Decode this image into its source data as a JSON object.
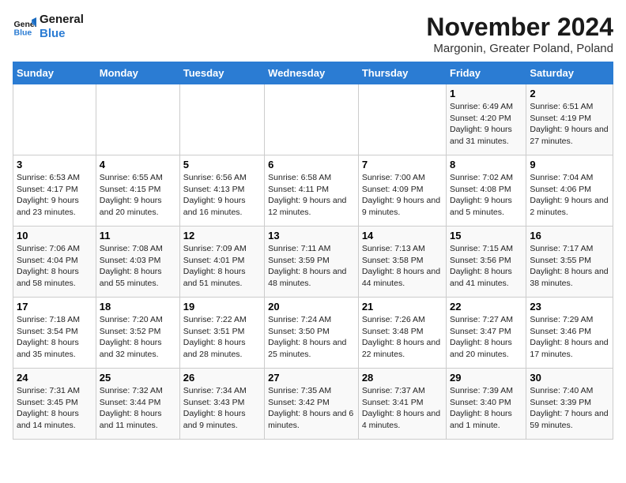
{
  "logo": {
    "line1": "General",
    "line2": "Blue"
  },
  "title": "November 2024",
  "subtitle": "Margonin, Greater Poland, Poland",
  "days_of_week": [
    "Sunday",
    "Monday",
    "Tuesday",
    "Wednesday",
    "Thursday",
    "Friday",
    "Saturday"
  ],
  "weeks": [
    [
      {
        "day": "",
        "info": ""
      },
      {
        "day": "",
        "info": ""
      },
      {
        "day": "",
        "info": ""
      },
      {
        "day": "",
        "info": ""
      },
      {
        "day": "",
        "info": ""
      },
      {
        "day": "1",
        "info": "Sunrise: 6:49 AM\nSunset: 4:20 PM\nDaylight: 9 hours and 31 minutes."
      },
      {
        "day": "2",
        "info": "Sunrise: 6:51 AM\nSunset: 4:19 PM\nDaylight: 9 hours and 27 minutes."
      }
    ],
    [
      {
        "day": "3",
        "info": "Sunrise: 6:53 AM\nSunset: 4:17 PM\nDaylight: 9 hours and 23 minutes."
      },
      {
        "day": "4",
        "info": "Sunrise: 6:55 AM\nSunset: 4:15 PM\nDaylight: 9 hours and 20 minutes."
      },
      {
        "day": "5",
        "info": "Sunrise: 6:56 AM\nSunset: 4:13 PM\nDaylight: 9 hours and 16 minutes."
      },
      {
        "day": "6",
        "info": "Sunrise: 6:58 AM\nSunset: 4:11 PM\nDaylight: 9 hours and 12 minutes."
      },
      {
        "day": "7",
        "info": "Sunrise: 7:00 AM\nSunset: 4:09 PM\nDaylight: 9 hours and 9 minutes."
      },
      {
        "day": "8",
        "info": "Sunrise: 7:02 AM\nSunset: 4:08 PM\nDaylight: 9 hours and 5 minutes."
      },
      {
        "day": "9",
        "info": "Sunrise: 7:04 AM\nSunset: 4:06 PM\nDaylight: 9 hours and 2 minutes."
      }
    ],
    [
      {
        "day": "10",
        "info": "Sunrise: 7:06 AM\nSunset: 4:04 PM\nDaylight: 8 hours and 58 minutes."
      },
      {
        "day": "11",
        "info": "Sunrise: 7:08 AM\nSunset: 4:03 PM\nDaylight: 8 hours and 55 minutes."
      },
      {
        "day": "12",
        "info": "Sunrise: 7:09 AM\nSunset: 4:01 PM\nDaylight: 8 hours and 51 minutes."
      },
      {
        "day": "13",
        "info": "Sunrise: 7:11 AM\nSunset: 3:59 PM\nDaylight: 8 hours and 48 minutes."
      },
      {
        "day": "14",
        "info": "Sunrise: 7:13 AM\nSunset: 3:58 PM\nDaylight: 8 hours and 44 minutes."
      },
      {
        "day": "15",
        "info": "Sunrise: 7:15 AM\nSunset: 3:56 PM\nDaylight: 8 hours and 41 minutes."
      },
      {
        "day": "16",
        "info": "Sunrise: 7:17 AM\nSunset: 3:55 PM\nDaylight: 8 hours and 38 minutes."
      }
    ],
    [
      {
        "day": "17",
        "info": "Sunrise: 7:18 AM\nSunset: 3:54 PM\nDaylight: 8 hours and 35 minutes."
      },
      {
        "day": "18",
        "info": "Sunrise: 7:20 AM\nSunset: 3:52 PM\nDaylight: 8 hours and 32 minutes."
      },
      {
        "day": "19",
        "info": "Sunrise: 7:22 AM\nSunset: 3:51 PM\nDaylight: 8 hours and 28 minutes."
      },
      {
        "day": "20",
        "info": "Sunrise: 7:24 AM\nSunset: 3:50 PM\nDaylight: 8 hours and 25 minutes."
      },
      {
        "day": "21",
        "info": "Sunrise: 7:26 AM\nSunset: 3:48 PM\nDaylight: 8 hours and 22 minutes."
      },
      {
        "day": "22",
        "info": "Sunrise: 7:27 AM\nSunset: 3:47 PM\nDaylight: 8 hours and 20 minutes."
      },
      {
        "day": "23",
        "info": "Sunrise: 7:29 AM\nSunset: 3:46 PM\nDaylight: 8 hours and 17 minutes."
      }
    ],
    [
      {
        "day": "24",
        "info": "Sunrise: 7:31 AM\nSunset: 3:45 PM\nDaylight: 8 hours and 14 minutes."
      },
      {
        "day": "25",
        "info": "Sunrise: 7:32 AM\nSunset: 3:44 PM\nDaylight: 8 hours and 11 minutes."
      },
      {
        "day": "26",
        "info": "Sunrise: 7:34 AM\nSunset: 3:43 PM\nDaylight: 8 hours and 9 minutes."
      },
      {
        "day": "27",
        "info": "Sunrise: 7:35 AM\nSunset: 3:42 PM\nDaylight: 8 hours and 6 minutes."
      },
      {
        "day": "28",
        "info": "Sunrise: 7:37 AM\nSunset: 3:41 PM\nDaylight: 8 hours and 4 minutes."
      },
      {
        "day": "29",
        "info": "Sunrise: 7:39 AM\nSunset: 3:40 PM\nDaylight: 8 hours and 1 minute."
      },
      {
        "day": "30",
        "info": "Sunrise: 7:40 AM\nSunset: 3:39 PM\nDaylight: 7 hours and 59 minutes."
      }
    ]
  ]
}
